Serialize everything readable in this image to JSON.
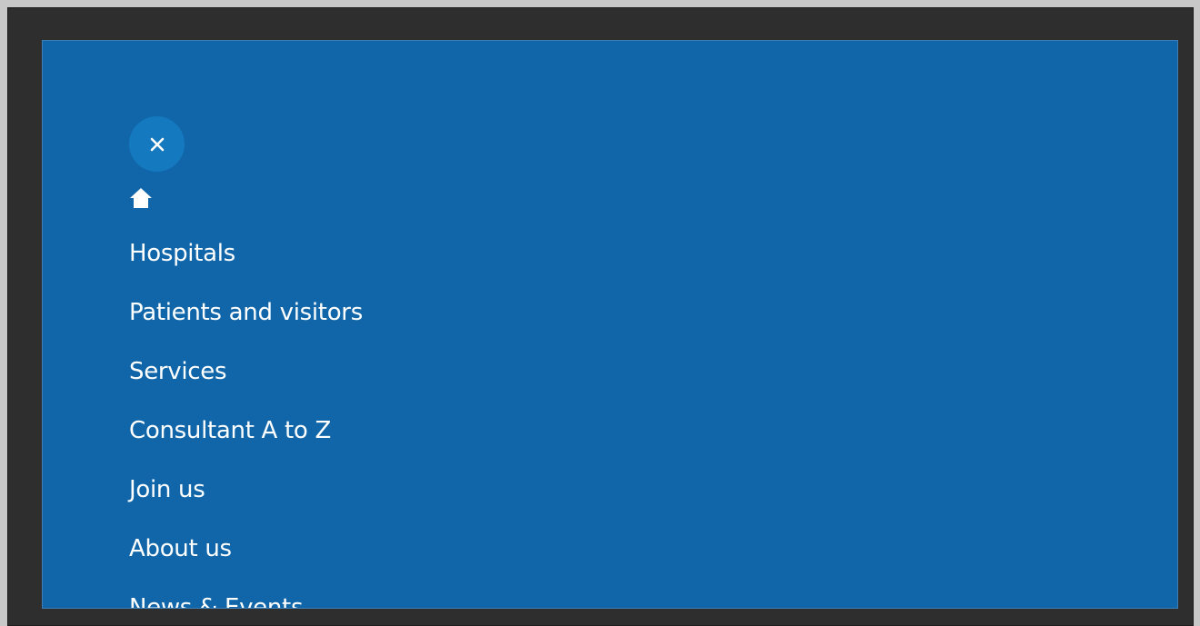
{
  "menu": {
    "close_icon": "close-icon",
    "home_icon": "home-icon",
    "items": [
      {
        "label": "Hospitals"
      },
      {
        "label": "Patients and visitors"
      },
      {
        "label": "Services"
      },
      {
        "label": "Consultant A to Z"
      },
      {
        "label": "Join us"
      },
      {
        "label": "About us"
      },
      {
        "label": "News & Events"
      }
    ]
  },
  "colors": {
    "panel_background": "#1066a8",
    "close_button_background": "#1579bf",
    "text": "#ffffff",
    "frame": "#2e2e2e"
  }
}
